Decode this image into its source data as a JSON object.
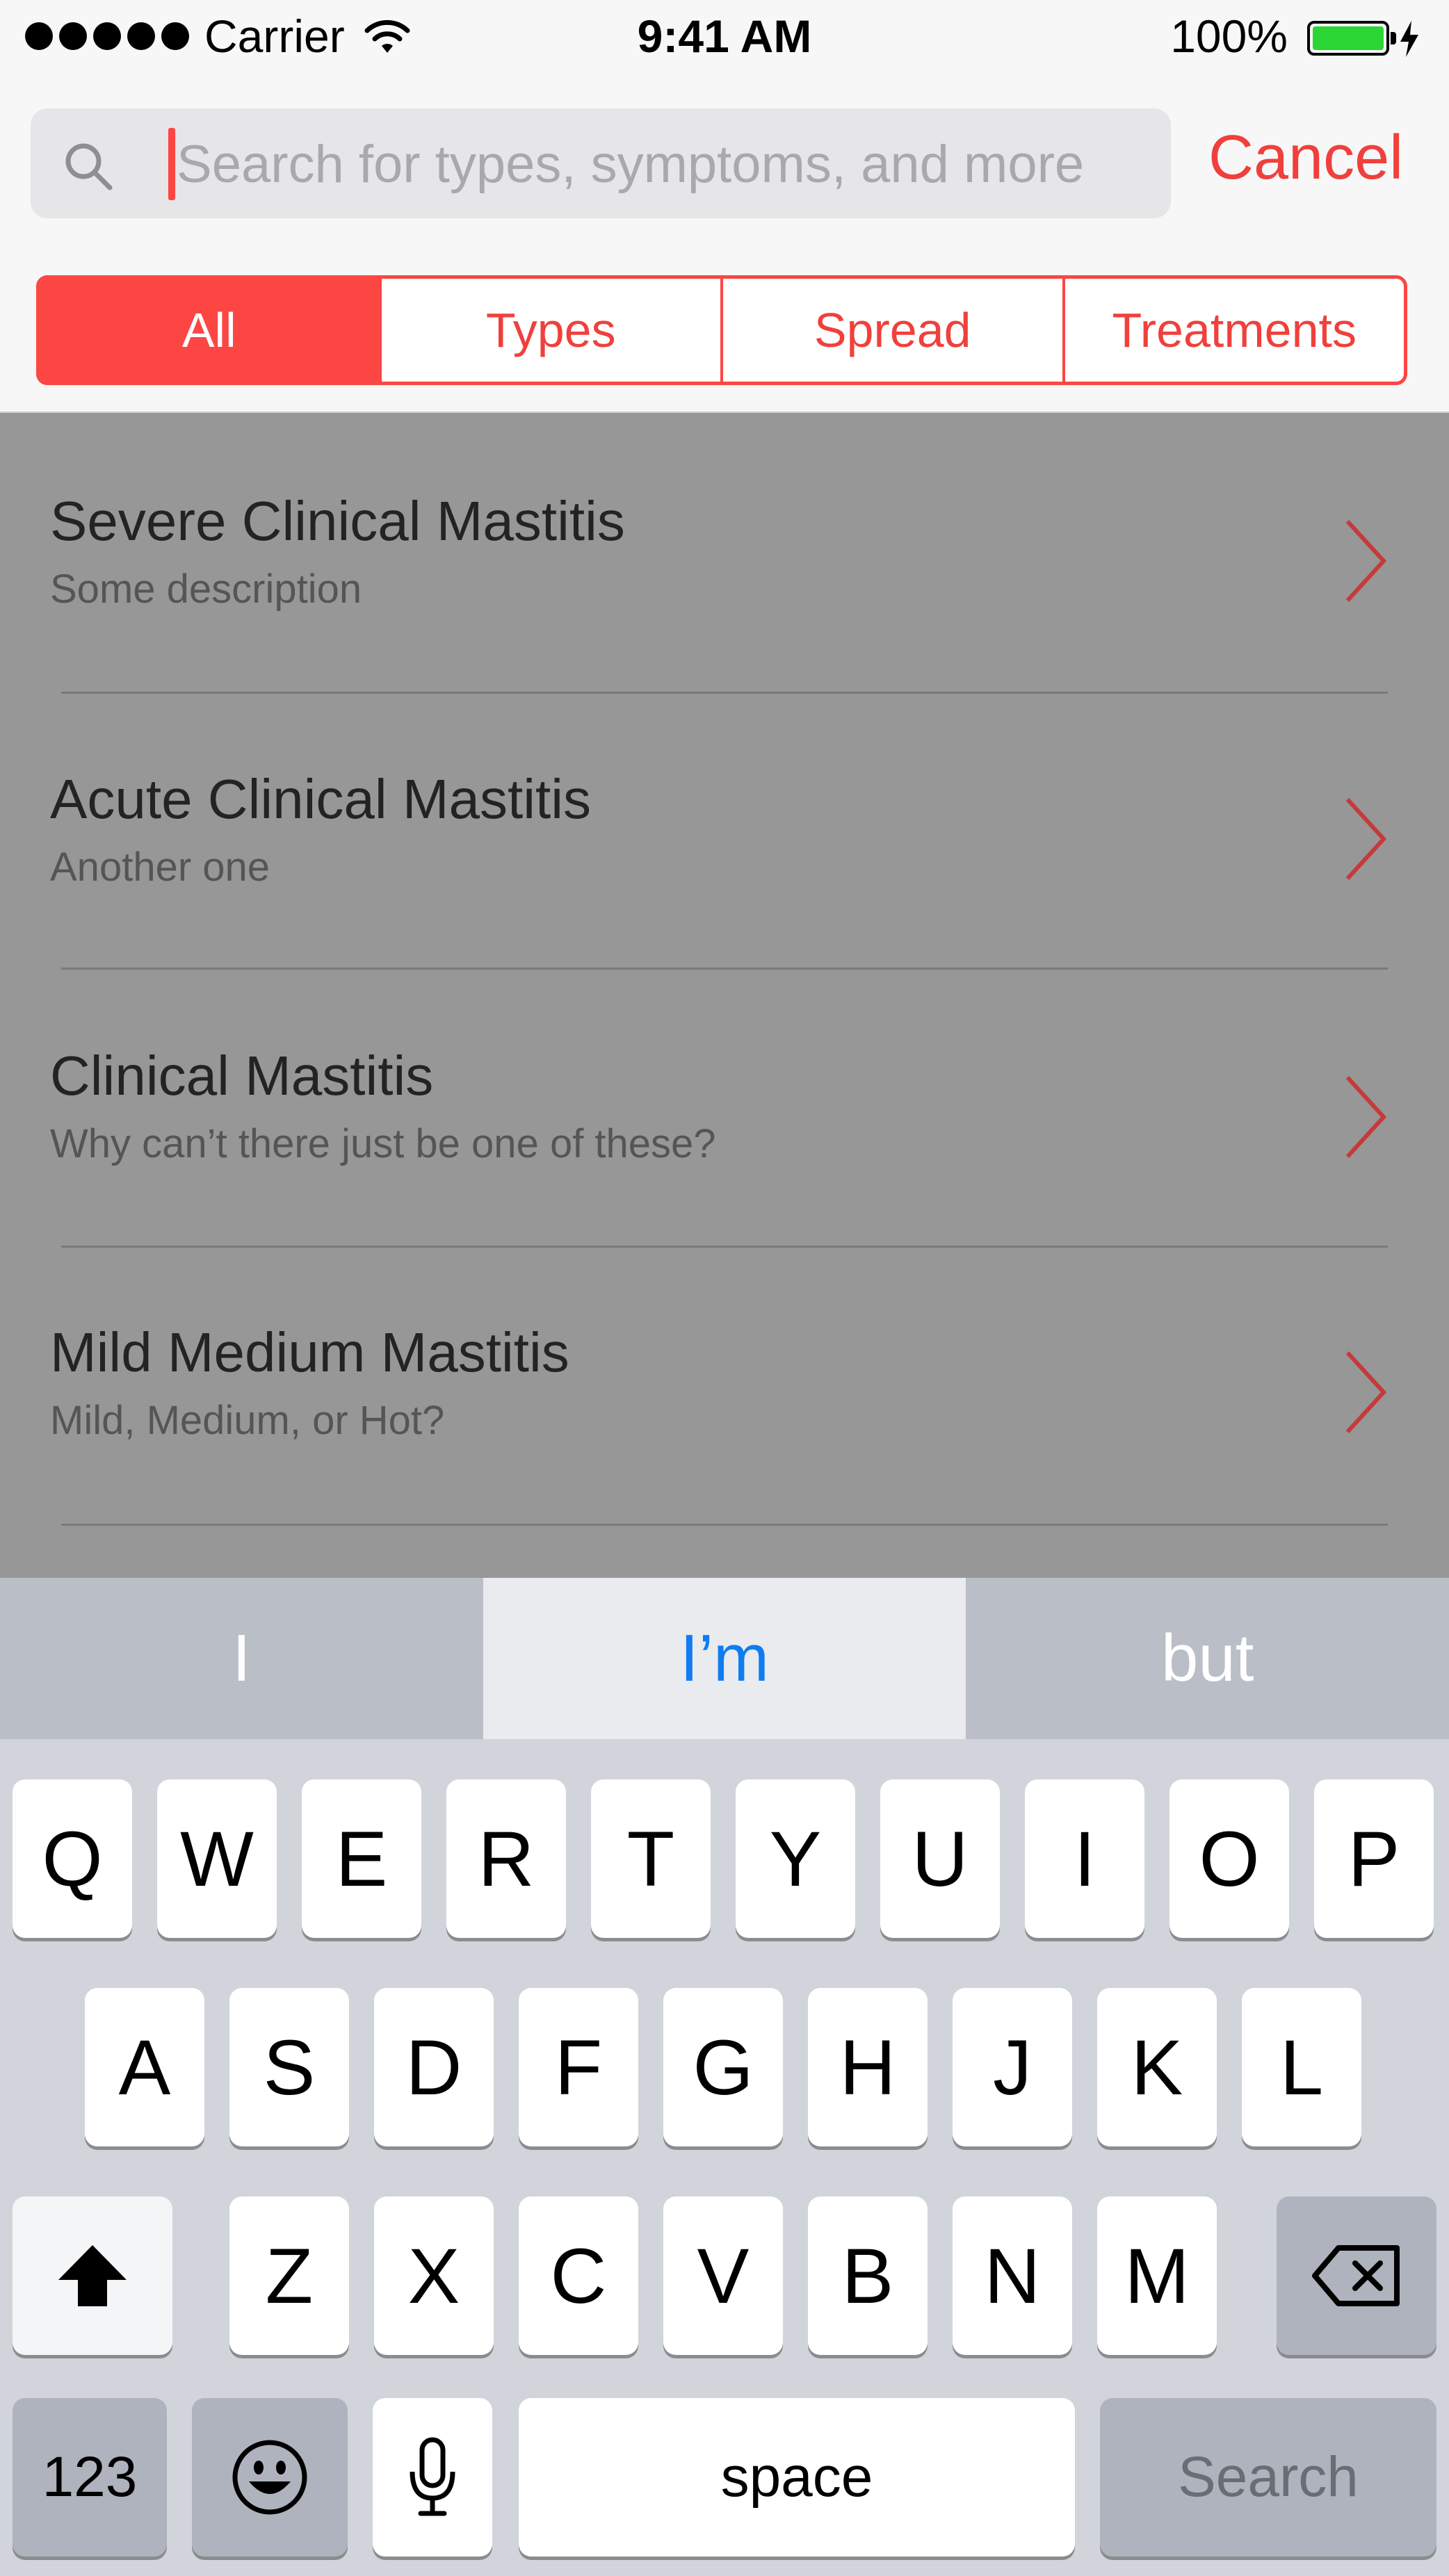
{
  "status_bar": {
    "carrier": "Carrier",
    "time": "9:41 AM",
    "battery": "100%"
  },
  "search": {
    "placeholder": "Search for types, symptoms, and more",
    "value": "",
    "cancel_label": "Cancel"
  },
  "segments": [
    {
      "label": "All",
      "selected": true
    },
    {
      "label": "Types",
      "selected": false
    },
    {
      "label": "Spread",
      "selected": false
    },
    {
      "label": "Treatments",
      "selected": false
    }
  ],
  "results": [
    {
      "title": "Severe Clinical Mastitis",
      "subtitle": "Some description"
    },
    {
      "title": "Acute Clinical Mastitis",
      "subtitle": "Another one"
    },
    {
      "title": "Clinical Mastitis",
      "subtitle": "Why can’t there just be one of these?"
    },
    {
      "title": "Mild Medium Mastitis",
      "subtitle": "Mild, Medium, or Hot?"
    }
  ],
  "keyboard": {
    "predictions": [
      "I",
      "I’m",
      "but"
    ],
    "row1": [
      "Q",
      "W",
      "E",
      "R",
      "T",
      "Y",
      "U",
      "I",
      "O",
      "P"
    ],
    "row2": [
      "A",
      "S",
      "D",
      "F",
      "G",
      "H",
      "J",
      "K",
      "L"
    ],
    "row3": [
      "Z",
      "X",
      "C",
      "V",
      "B",
      "N",
      "M"
    ],
    "numbers_label": "123",
    "space_label": "space",
    "search_label": "Search"
  },
  "colors": {
    "accent": "#fc4644",
    "battery": "#2bd634",
    "prediction_highlight": "#0f7cf2"
  }
}
